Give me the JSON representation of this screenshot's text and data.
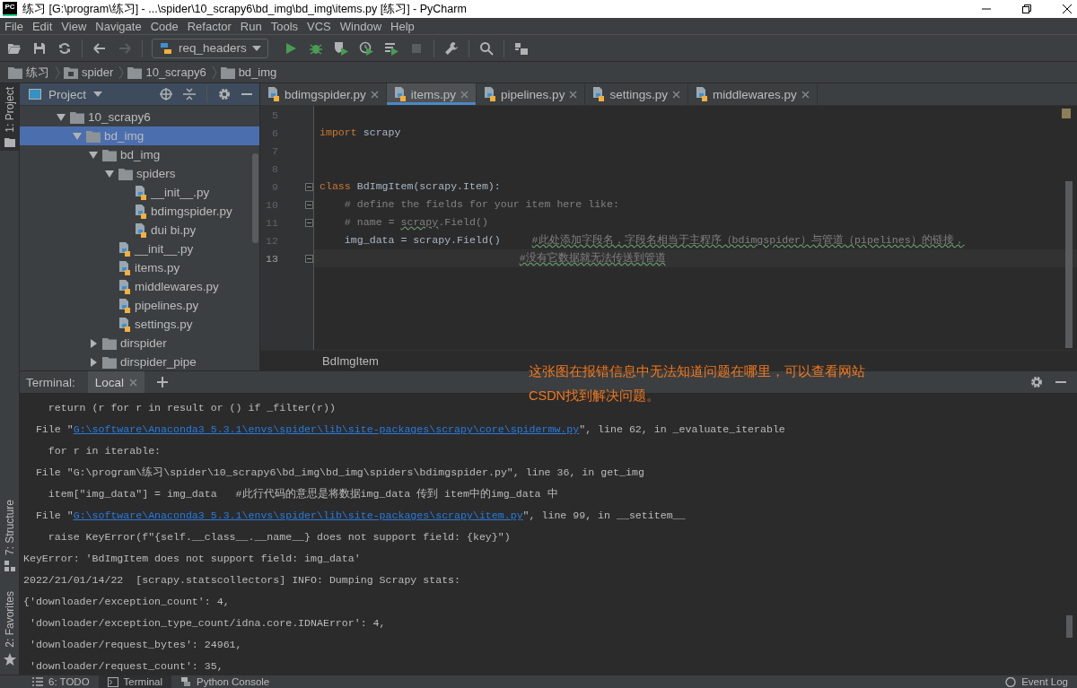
{
  "window": {
    "app_icon_text": "PC",
    "title": "练习 [G:\\program\\练习] - ...\\spider\\10_scrapy6\\bd_img\\bd_img\\items.py [练习] - PyCharm"
  },
  "menu": [
    "File",
    "Edit",
    "View",
    "Navigate",
    "Code",
    "Refactor",
    "Run",
    "Tools",
    "VCS",
    "Window",
    "Help"
  ],
  "toolbar": [
    {
      "kind": "open",
      "disabled": false
    },
    {
      "kind": "save",
      "disabled": false
    },
    {
      "kind": "sync",
      "disabled": false
    },
    {
      "kind": "separator"
    },
    {
      "kind": "back",
      "disabled": false
    },
    {
      "kind": "forward",
      "disabled": true
    },
    {
      "kind": "separator"
    },
    {
      "kind": "run_config",
      "label": "req_headers"
    },
    {
      "kind": "run",
      "disabled": false
    },
    {
      "kind": "debug",
      "disabled": false
    },
    {
      "kind": "coverage",
      "disabled": false
    },
    {
      "kind": "profile",
      "disabled": false
    },
    {
      "kind": "concurrency",
      "disabled": false
    },
    {
      "kind": "stop",
      "disabled": true
    },
    {
      "kind": "separator"
    },
    {
      "kind": "wrench",
      "disabled": false
    },
    {
      "kind": "separator"
    },
    {
      "kind": "search",
      "disabled": false
    },
    {
      "kind": "separator"
    },
    {
      "kind": "structure",
      "disabled": false
    }
  ],
  "breadcrumb": [
    {
      "label": "练习",
      "kind": "folder"
    },
    {
      "label": "spider",
      "kind": "module"
    },
    {
      "label": "10_scrapy6",
      "kind": "folder"
    },
    {
      "label": "bd_img",
      "kind": "folder"
    }
  ],
  "side_stripe": {
    "top": [
      {
        "label": "1: Project",
        "selected": true,
        "kind": "folder"
      }
    ],
    "bottom": [
      {
        "label": "7: Structure",
        "selected": false,
        "kind": "structure"
      },
      {
        "label": "2: Favorites",
        "selected": false,
        "kind": "star"
      }
    ]
  },
  "project_panel": {
    "title": "Project",
    "tree": [
      {
        "label": "10_scrapy6",
        "kind": "folder",
        "expanded": true,
        "selected": false,
        "children": [
          {
            "label": "bd_img",
            "kind": "folder",
            "expanded": true,
            "selected": true,
            "children": [
              {
                "label": "bd_img",
                "kind": "folder",
                "expanded": true,
                "selected": false,
                "children": [
                  {
                    "label": "spiders",
                    "kind": "folder",
                    "expanded": true,
                    "selected": false,
                    "children": [
                      {
                        "label": "__init__.py",
                        "kind": "file",
                        "selected": false
                      },
                      {
                        "label": "bdimgspider.py",
                        "kind": "file",
                        "selected": false
                      },
                      {
                        "label": "dui bi.py",
                        "kind": "file",
                        "selected": false
                      }
                    ]
                  },
                  {
                    "label": "__init__.py",
                    "kind": "file",
                    "selected": false
                  },
                  {
                    "label": "items.py",
                    "kind": "file",
                    "selected": false
                  },
                  {
                    "label": "middlewares.py",
                    "kind": "file",
                    "selected": false
                  },
                  {
                    "label": "pipelines.py",
                    "kind": "file",
                    "selected": false
                  },
                  {
                    "label": "settings.py",
                    "kind": "file",
                    "selected": false
                  }
                ]
              },
              {
                "label": "dirspider",
                "kind": "folder",
                "expanded": false,
                "selected": false
              },
              {
                "label": "dirspider_pipe",
                "kind": "folder",
                "expanded": false,
                "selected": false
              }
            ]
          }
        ]
      }
    ]
  },
  "editor": {
    "tabs": [
      {
        "label": "bdimgspider.py",
        "selected": false
      },
      {
        "label": "items.py",
        "selected": true
      },
      {
        "label": "pipelines.py",
        "selected": false
      },
      {
        "label": "settings.py",
        "selected": false
      },
      {
        "label": "middlewares.py",
        "selected": false
      }
    ],
    "lines": [
      {
        "number": "5",
        "fold": false,
        "current": false
      },
      {
        "number": "6",
        "fold": false,
        "current": false,
        "tokens": [
          {
            "text": "import",
            "kind": "keyword"
          },
          {
            "text": " scrapy",
            "kind": "plain"
          }
        ]
      },
      {
        "number": "7",
        "fold": false,
        "current": false
      },
      {
        "number": "8",
        "fold": false,
        "current": false
      },
      {
        "number": "9",
        "fold": true,
        "current": false,
        "tokens": [
          {
            "text": "class",
            "kind": "keyword"
          },
          {
            "text": " BdImgItem(scrapy.Item):",
            "kind": "plain"
          }
        ]
      },
      {
        "number": "10",
        "fold": true,
        "current": false,
        "tokens": [
          {
            "text": "    # define the fields for your item here like:",
            "kind": "comment"
          }
        ]
      },
      {
        "number": "11",
        "fold": true,
        "current": false,
        "tokens": [
          {
            "text": "    # name = ",
            "kind": "comment"
          },
          {
            "text": "scrapy",
            "kind": "comment_typo"
          },
          {
            "text": ".Field()",
            "kind": "comment"
          }
        ]
      },
      {
        "number": "12",
        "fold": false,
        "current": false,
        "tokens": [
          {
            "text": "    img_data = scrapy.Field()     ",
            "kind": "plain"
          },
          {
            "text": "#此处添加字段名，字段名相当于主程序（bdimgspider）与管道（pipelines）的链接，",
            "kind": "comment_typo"
          }
        ]
      },
      {
        "number": "13",
        "fold": true,
        "current": true,
        "tokens": [
          {
            "text": "                                #没有它数据就无法传送到管道",
            "kind": "comment_typo"
          }
        ]
      }
    ],
    "breadcrumb": "BdImgItem"
  },
  "annotation": {
    "lines": [
      "这张图在报错信息中无法知道问题在哪里，可以查看网站",
      "CSDN找到解决问题。"
    ]
  },
  "terminal": {
    "label": "Terminal:",
    "tabs": [
      {
        "label": "Local",
        "selected": true
      }
    ],
    "lines": [
      [
        {
          "text": "    return (r for r in result or () if _filter(r))",
          "link": false
        }
      ],
      [
        {
          "text": "  File \"",
          "link": false
        },
        {
          "text": "G:\\software\\Anaconda3 5.3.1\\envs\\spider\\lib\\site-packages\\scrapy\\core\\spidermw.py",
          "link": true
        },
        {
          "text": "\", line 62, in _evaluate_iterable",
          "link": false
        }
      ],
      [
        {
          "text": "    for r in iterable:",
          "link": false
        }
      ],
      [
        {
          "text": "  File \"G:\\program\\练习\\spider\\10_scrapy6\\bd_img\\bd_img\\spiders\\bdimgspider.py\", line 36, in get_img",
          "link": false
        }
      ],
      [
        {
          "text": "    item[\"img_data\"] = img_data   #此行代码的意思是将数据img_data 传到 item中的img_data 中",
          "link": false
        }
      ],
      [
        {
          "text": "  File \"",
          "link": false
        },
        {
          "text": "G:\\software\\Anaconda3 5.3.1\\envs\\spider\\lib\\site-packages\\scrapy\\item.py",
          "link": true
        },
        {
          "text": "\", line 99, in __setitem__",
          "link": false
        }
      ],
      [
        {
          "text": "    raise KeyError(f\"{self.__class__.__name__} does not support field: {key}\")",
          "link": false
        }
      ],
      [
        {
          "text": "KeyError: 'BdImgItem does not support field: img_data'",
          "link": false
        }
      ],
      [
        {
          "text": "2022/21/01/14/22  [scrapy.statscollectors] INFO: Dumping Scrapy stats:",
          "link": false
        }
      ],
      [
        {
          "text": "{'downloader/exception_count': 4,",
          "link": false
        }
      ],
      [
        {
          "text": " 'downloader/exception_type_count/idna.core.IDNAError': 4,",
          "link": false
        }
      ],
      [
        {
          "text": " 'downloader/request_bytes': 24961,",
          "link": false
        }
      ],
      [
        {
          "text": " 'downloader/request_count': 35,",
          "link": false
        }
      ]
    ]
  },
  "bottom_bar": {
    "tabs": [
      {
        "label": "6: TODO",
        "selected": false,
        "kind": "todo"
      },
      {
        "label": "Terminal",
        "selected": true,
        "kind": "terminal"
      },
      {
        "label": "Python Console",
        "selected": false,
        "kind": "python"
      }
    ],
    "event_log": "Event Log"
  }
}
